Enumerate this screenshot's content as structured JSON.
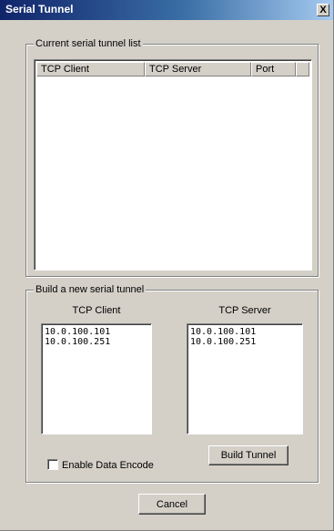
{
  "window": {
    "title": "Serial Tunnel",
    "close_glyph": "X"
  },
  "current_list": {
    "group_label": "Current serial tunnel list",
    "columns": [
      "TCP Client",
      "TCP Server",
      "Port"
    ],
    "rows": []
  },
  "build": {
    "group_label": "Build a new serial tunnel",
    "client_label": "TCP Client",
    "server_label": "TCP Server",
    "client_items": [
      "10.0.100.101",
      "10.0.100.251"
    ],
    "server_items": [
      "10.0.100.101",
      "10.0.100.251"
    ],
    "encode_label": "Enable Data Encode",
    "encode_checked": false,
    "build_button": "Build Tunnel"
  },
  "cancel_button": "Cancel"
}
